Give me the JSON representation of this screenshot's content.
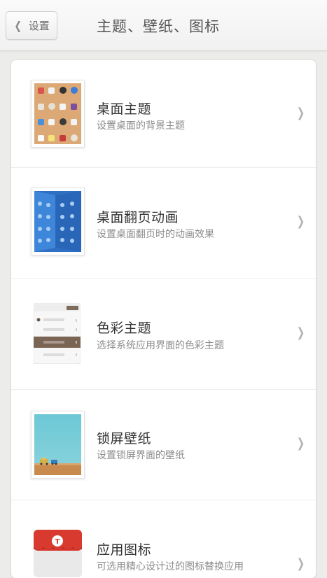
{
  "header": {
    "back_label": "设置",
    "title": "主题、壁纸、图标"
  },
  "items": [
    {
      "title": "桌面主题",
      "desc": "设置桌面的背景主题",
      "icon": "theme-thumbnail-icon"
    },
    {
      "title": "桌面翻页动画",
      "desc": "设置桌面翻页时的动画效果",
      "icon": "page-animation-thumbnail-icon"
    },
    {
      "title": "色彩主题",
      "desc": "选择系统应用界面的色彩主题",
      "icon": "color-theme-thumbnail-icon"
    },
    {
      "title": "锁屏壁纸",
      "desc": "设置锁屏界面的壁纸",
      "icon": "lockscreen-wallpaper-thumbnail-icon"
    },
    {
      "title": "应用图标",
      "desc": "可选用精心设计过的图标替换应用",
      "icon": "app-icon-thumbnail-icon"
    }
  ],
  "colors": {
    "background": "#ececea",
    "card": "#ffffff",
    "title_text": "#333333",
    "desc_text": "#8c8c8c",
    "chevron": "#b2b2b2"
  }
}
